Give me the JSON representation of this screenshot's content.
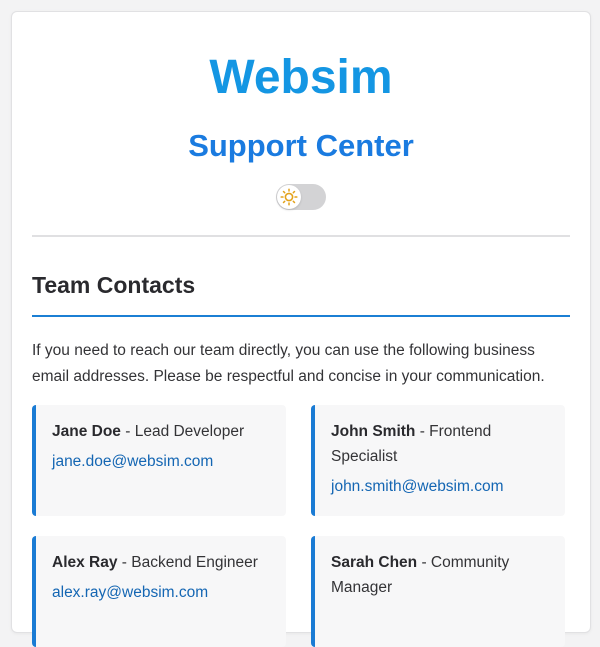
{
  "header": {
    "brand": "Websim",
    "subtitle": "Support Center",
    "theme_toggle_icon": "sun-icon"
  },
  "contacts_section": {
    "title": "Team Contacts",
    "intro": "If you need to reach our team directly, you can use the following business email addresses. Please be respectful and concise in your communication.",
    "contacts": [
      {
        "name": "Jane Doe",
        "separator": " - ",
        "role": "Lead Developer",
        "email": "jane.doe@websim.com"
      },
      {
        "name": "John Smith",
        "separator": " - ",
        "role": "Frontend Specialist",
        "email": "john.smith@websim.com"
      },
      {
        "name": "Alex Ray",
        "separator": " - ",
        "role": "Backend Engineer",
        "email": "alex.ray@websim.com"
      },
      {
        "name": "Sarah Chen",
        "separator": " - ",
        "role": "Community Manager",
        "email": ""
      }
    ]
  },
  "colors": {
    "brand": "#1496e3",
    "subtitle": "#1a7be0",
    "accent": "#1a7bd4",
    "link": "#1466b3"
  }
}
